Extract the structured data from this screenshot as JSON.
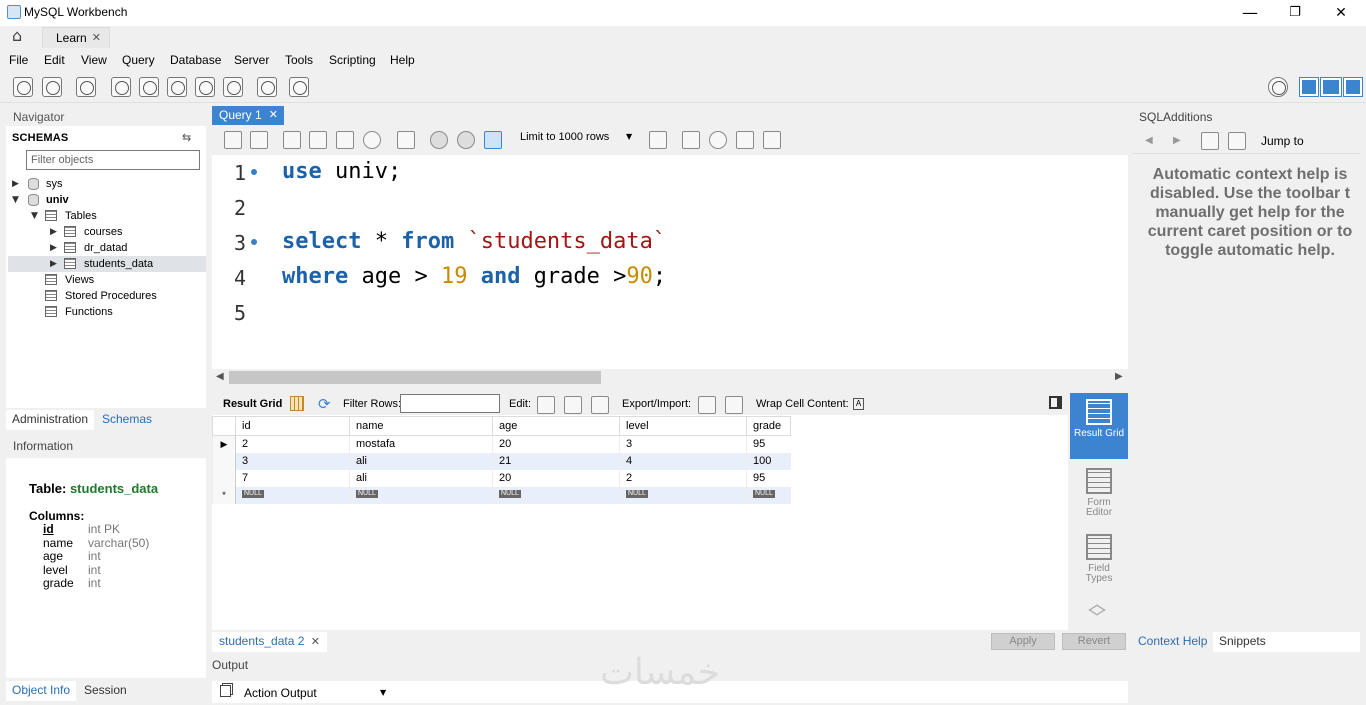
{
  "window": {
    "title": "MySQL Workbench",
    "minimize": "—",
    "maximize": "❐",
    "close": "✕"
  },
  "connection_tab": {
    "label": "Learn",
    "close": "✕"
  },
  "menu": [
    "File",
    "Edit",
    "View",
    "Query",
    "Database",
    "Server",
    "Tools",
    "Scripting",
    "Help"
  ],
  "navigator": {
    "title": "Navigator",
    "schemas_label": "SCHEMAS",
    "filter_placeholder": "Filter objects",
    "tree": {
      "sys": "sys",
      "univ": "univ",
      "tables": "Tables",
      "table_items": [
        "courses",
        "dr_datad",
        "students_data"
      ],
      "views": "Views",
      "procedures": "Stored Procedures",
      "functions": "Functions"
    },
    "tabs": [
      "Administration",
      "Schemas"
    ]
  },
  "information": {
    "title": "Information",
    "table_label": "Table:",
    "table_name": "students_data",
    "columns_label": "Columns:",
    "columns": [
      {
        "name": "id",
        "type": "int PK"
      },
      {
        "name": "name",
        "type": "varchar(50)"
      },
      {
        "name": "age",
        "type": "int"
      },
      {
        "name": "level",
        "type": "int"
      },
      {
        "name": "grade",
        "type": "int"
      }
    ],
    "tabs": [
      "Object Info",
      "Session"
    ]
  },
  "query": {
    "tab_label": "Query 1",
    "tab_close": "✕",
    "limit_label": "Limit to 1000 rows",
    "line_numbers": [
      "1",
      "2",
      "3",
      "4",
      "5"
    ],
    "lines": {
      "l1_kw": "use",
      "l1_rest": " univ;",
      "l3_kw1": "select",
      "l3_mid": " * ",
      "l3_kw2": "from",
      "l3_str": " `students_data`",
      "l4_kw1": "where",
      "l4_a": " age > ",
      "l4_n1": "19",
      "l4_kw2": " and",
      "l4_b": " grade >",
      "l4_n2": "90",
      "l4_end": ";"
    }
  },
  "result": {
    "bar": {
      "result_grid": "Result Grid",
      "filter_rows": "Filter Rows:",
      "edit": "Edit:",
      "export_import": "Export/Import:",
      "wrap": "Wrap Cell Content:"
    },
    "columns": [
      "id",
      "name",
      "age",
      "level",
      "grade"
    ],
    "rows": [
      [
        "2",
        "mostafa",
        "20",
        "3",
        "95"
      ],
      [
        "3",
        "ali",
        "21",
        "4",
        "100"
      ],
      [
        "7",
        "ali",
        "20",
        "2",
        "95"
      ]
    ],
    "null_label": "NULL",
    "new_row_marker": "*",
    "current_row_marker": "▶",
    "side_buttons": [
      "Result Grid",
      "Form Editor",
      "Field Types"
    ],
    "result_tab": "students_data 2",
    "result_tab_close": "✕",
    "apply": "Apply",
    "revert": "Revert"
  },
  "output": {
    "title": "Output",
    "selector": "Action Output"
  },
  "sqladditions": {
    "title": "SQLAdditions",
    "jump_to": "Jump to",
    "help_lines": [
      "Automatic context help is",
      "disabled. Use the toolbar t",
      "manually get help for the",
      "current caret position or to",
      "toggle automatic help."
    ],
    "tabs": [
      "Context Help",
      "Snippets"
    ]
  },
  "watermark": "خمسات",
  "colors": {
    "accent": "#3c84d0",
    "keyword": "#1c62a8",
    "string": "#a31515",
    "number": "#c98a00"
  }
}
